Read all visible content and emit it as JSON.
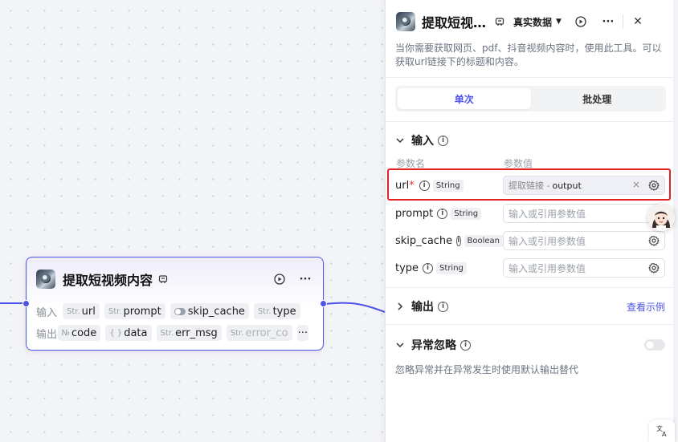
{
  "canvas": {
    "node": {
      "title": "提取短视频内容",
      "input_label": "输入",
      "output_label": "输出",
      "inputs": [
        {
          "type_badge": "Str.",
          "name": "url"
        },
        {
          "type_badge": "Str.",
          "name": "prompt"
        },
        {
          "type_badge": "",
          "name": "skip_cache"
        },
        {
          "type_badge": "Str.",
          "name": "type"
        }
      ],
      "outputs": [
        {
          "type_badge": "№",
          "name": "code"
        },
        {
          "type_badge": "{ }",
          "name": "data"
        },
        {
          "type_badge": "Str.",
          "name": "err_msg"
        },
        {
          "type_badge": "Str.",
          "name": "error_co"
        }
      ],
      "more": "···"
    }
  },
  "panel": {
    "title": "提取短视…",
    "mode_select": "真实数据",
    "more": "···",
    "close": "✕",
    "description": "当你需要获取网页、pdf、抖音视频内容时，使用此工具。可以获取url链接下的标题和内容。",
    "tabs": [
      {
        "label": "单次",
        "active": true
      },
      {
        "label": "批处理",
        "active": false
      }
    ],
    "input_section": {
      "title": "输入",
      "col_name": "参数名",
      "col_value": "参数值",
      "params": [
        {
          "name": "url",
          "required": "*",
          "type": "String",
          "ref_source": "提取链接 -",
          "ref_output": "output",
          "clear": "×"
        },
        {
          "name": "prompt",
          "type": "String",
          "placeholder": "输入或引用参数值"
        },
        {
          "name": "skip_cache",
          "type": "Boolean",
          "placeholder": "输入或引用参数值"
        },
        {
          "name": "type",
          "type": "String",
          "placeholder": "输入或引用参数值"
        }
      ]
    },
    "output_section": {
      "title": "输出",
      "link": "查看示例"
    },
    "exception_section": {
      "title": "异常忽略",
      "hint": "忽略异常并在异常发生时使用默认输出替代",
      "enabled": false
    }
  },
  "colors": {
    "accent": "#4d53e8",
    "highlight": "#e32222"
  }
}
